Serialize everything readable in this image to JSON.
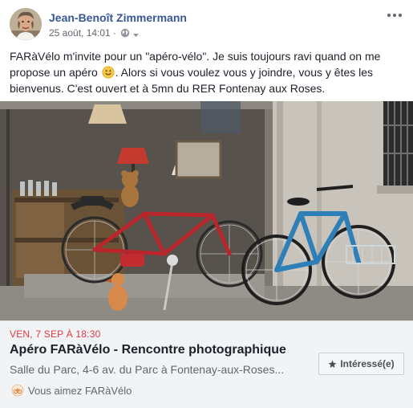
{
  "post": {
    "author": "Jean-Benoît Zimmermann",
    "timestamp": "25 août, 14:01",
    "separator": "·",
    "audience_icon": "globe-icon",
    "audience_menu_icon": "caret-down-icon",
    "options_icon": "more-horizontal-icon",
    "text_part1": "FARàVélo m'invite pour un \"apéro-vélo\". Je suis toujours ravi quand on me propose un apéro",
    "text_emoji": "smile-emoji",
    "text_part2": ". Alors si vous voulez vous y joindre, vous y êtes les bienvenus. C'est ouvert et à 5mn du RER Fontenay aux Roses."
  },
  "event": {
    "date": "VEN, 7 SEP À 18:30",
    "title": "Apéro FARàVélo - Rencontre photographique",
    "location": "Salle du Parc, 4-6 av. du Parc à Fontenay-aux-Roses...",
    "interested_label": "Intéressé(e)",
    "interested_icon": "star-icon",
    "social_context": "Vous aimez FARàVélo",
    "social_icon": "page-like-icon"
  },
  "colors": {
    "author_link": "#385898",
    "date_red": "#e0393e",
    "event_bg": "#f2f3f5",
    "text": "#1d2129",
    "muted": "#606770"
  }
}
